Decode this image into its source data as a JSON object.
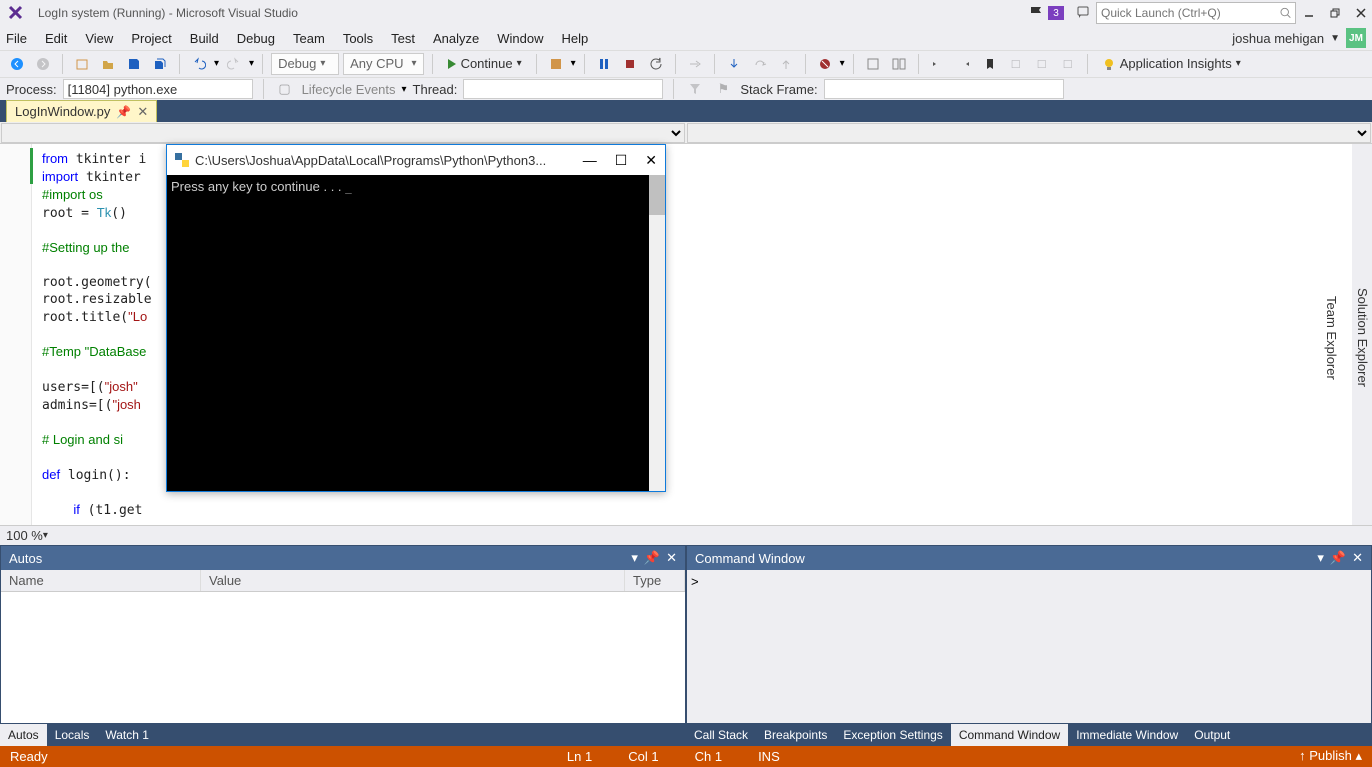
{
  "titlebar": {
    "title": "LogIn system (Running) - Microsoft Visual Studio",
    "notif_count": "3",
    "search_placeholder": "Quick Launch (Ctrl+Q)"
  },
  "menubar": {
    "items": [
      "File",
      "Edit",
      "View",
      "Project",
      "Build",
      "Debug",
      "Team",
      "Tools",
      "Test",
      "Analyze",
      "Window",
      "Help"
    ],
    "user": "joshua mehigan",
    "user_initials": "JM"
  },
  "toolbar": {
    "config": "Debug",
    "platform": "Any CPU",
    "continue": "Continue",
    "insights": "Application Insights"
  },
  "toolbar2": {
    "process_label": "Process:",
    "process_value": "[11804] python.exe",
    "lifecycle": "Lifecycle Events",
    "thread_label": "Thread:",
    "stack_label": "Stack Frame:"
  },
  "tabs": {
    "file": "LogInWindow.py"
  },
  "code_lines": [
    {
      "t": "from tkinter i",
      "cls": "kw-part"
    },
    {
      "t": "import tkinter",
      "cls": "kw-part"
    },
    {
      "t": "#import os",
      "cls": "cmt"
    },
    {
      "t": "root = Tk()",
      "cls": "assign"
    },
    {
      "t": ""
    },
    {
      "t": "#Setting up the",
      "cls": "cmt"
    },
    {
      "t": ""
    },
    {
      "t": "root.geometry("
    },
    {
      "t": "root.resizable"
    },
    {
      "t": "root.title(\"Lo",
      "cls": "has-str"
    },
    {
      "t": ""
    },
    {
      "t": "#Temp \"DataBase",
      "cls": "cmt"
    },
    {
      "t": ""
    },
    {
      "t": "users=[(\"josh\"",
      "cls": "has-str"
    },
    {
      "t": "admins=[(\"josh",
      "cls": "has-str"
    },
    {
      "t": ""
    },
    {
      "t": "# Login and si",
      "cls": "cmt"
    },
    {
      "t": ""
    },
    {
      "t": "def login():",
      "cls": "kw-def"
    },
    {
      "t": ""
    },
    {
      "t": "    if (t1.get",
      "cls": "kw-if"
    }
  ],
  "zoom": "100 %",
  "console": {
    "title": "C:\\Users\\Joshua\\AppData\\Local\\Programs\\Python\\Python3...",
    "text": "Press any key to continue . . . "
  },
  "panels": {
    "autos": {
      "title": "Autos",
      "cols": [
        "Name",
        "Value",
        "Type"
      ]
    },
    "command": {
      "title": "Command Window",
      "prompt": ">"
    },
    "left_tabs": [
      "Autos",
      "Locals",
      "Watch 1"
    ],
    "right_tabs": [
      "Call Stack",
      "Breakpoints",
      "Exception Settings",
      "Command Window",
      "Immediate Window",
      "Output"
    ],
    "right_active": "Command Window",
    "left_active": "Autos"
  },
  "side_tools": [
    "Solution Explorer",
    "Team Explorer"
  ],
  "status": {
    "ready": "Ready",
    "line": "Ln 1",
    "col": "Col 1",
    "ch": "Ch 1",
    "ins": "INS",
    "publish": "Publish"
  }
}
